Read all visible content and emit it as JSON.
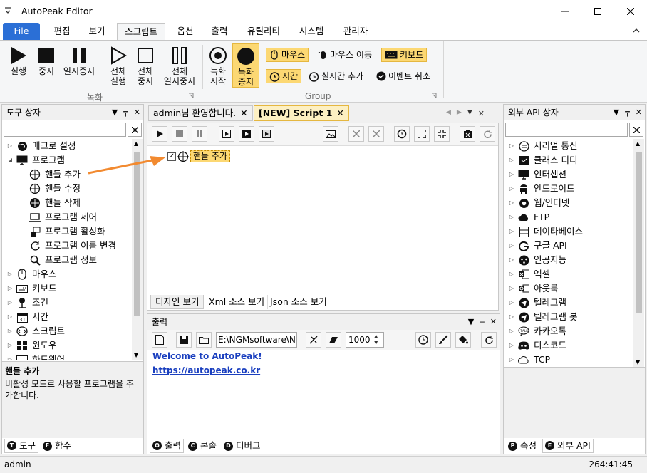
{
  "window": {
    "title": "AutoPeak Editor",
    "status_user": "admin",
    "status_time": "264:41:45"
  },
  "menu": {
    "file": "File",
    "items": [
      "편집",
      "보기",
      "스크립트",
      "옵션",
      "출력",
      "유틸리티",
      "시스템",
      "관리자"
    ]
  },
  "ribbon": {
    "record_group": "녹화",
    "group2": "Group",
    "run": "실행",
    "stop": "중지",
    "pause": "일시중지",
    "all_run": [
      "전체",
      "실행"
    ],
    "all_stop": [
      "전체",
      "중지"
    ],
    "all_pause": [
      "전체",
      "일시중지"
    ],
    "rec_start": [
      "녹화",
      "시작"
    ],
    "rec_stop": [
      "녹화",
      "중지"
    ],
    "mouse": "마우스",
    "mouse_move": "마우스 이동",
    "keyboard": "키보드",
    "time": "시간",
    "realtime_add": "실시간 추가",
    "event_cancel": "이벤트 취소"
  },
  "tool_box": {
    "title": "도구 상자",
    "items": [
      {
        "label": "매크로 설정",
        "icon": "globe-icon"
      },
      {
        "label": "프로그램",
        "icon": "monitor-icon"
      },
      {
        "label": "핸들 추가",
        "icon": "crosshair-icon"
      },
      {
        "label": "핸들 수정",
        "icon": "crosshair-icon"
      },
      {
        "label": "핸들 삭제",
        "icon": "crosshair-filled-icon"
      },
      {
        "label": "프로그램 제어",
        "icon": "laptop-icon"
      },
      {
        "label": "프로그램 활성화",
        "icon": "windows-stack-icon"
      },
      {
        "label": "프로그램 이름 변경",
        "icon": "rename-icon"
      },
      {
        "label": "프로그램 정보",
        "icon": "magnifier-icon"
      },
      {
        "label": "마우스",
        "icon": "mouse-icon"
      },
      {
        "label": "키보드",
        "icon": "keyboard-icon"
      },
      {
        "label": "조건",
        "icon": "condition-icon"
      },
      {
        "label": "시간",
        "icon": "calendar-icon"
      },
      {
        "label": "스크립트",
        "icon": "script-icon"
      },
      {
        "label": "윈도우",
        "icon": "windows-icon"
      },
      {
        "label": "하드웨어",
        "icon": "hardware-icon"
      }
    ],
    "desc_title": "핸들 추가",
    "desc_text": "비활성 모드로 사용할 프로그램을 추가합니다.",
    "tabs": [
      "도구",
      "함수"
    ],
    "tab_letters": [
      "T",
      "F"
    ]
  },
  "editor": {
    "tabs": [
      "admin님 환영합니다.",
      "[NEW] Script 1"
    ],
    "node_label": "핸들 추가",
    "view_tabs": [
      "디자인 보기",
      "Xml 소스 보기",
      "Json 소스 보기"
    ]
  },
  "output": {
    "title": "출력",
    "path": "E:\\NGMsoftware\\NG",
    "number": "1000",
    "welcome": "Welcome to AutoPeak!",
    "link": "https://autopeak.co.kr",
    "tabs": [
      "출력",
      "콘솔",
      "디버그"
    ],
    "tab_letters": [
      "O",
      "C",
      "D"
    ]
  },
  "api_box": {
    "title": "외부 API 상자",
    "items": [
      {
        "label": "시리얼 통신",
        "icon": "serial-icon"
      },
      {
        "label": "클래스 디디",
        "icon": "classdd-icon"
      },
      {
        "label": "인터셉션",
        "icon": "monitor-icon"
      },
      {
        "label": "안드로이드",
        "icon": "android-icon"
      },
      {
        "label": "웹/인터넷",
        "icon": "chrome-icon"
      },
      {
        "label": "FTP",
        "icon": "cloud-icon"
      },
      {
        "label": "데이타베이스",
        "icon": "database-icon"
      },
      {
        "label": "구글 API",
        "icon": "google-icon"
      },
      {
        "label": "인공지능",
        "icon": "ai-icon"
      },
      {
        "label": "엑셀",
        "icon": "excel-icon"
      },
      {
        "label": "아웃룩",
        "icon": "outlook-icon"
      },
      {
        "label": "텔레그램",
        "icon": "telegram-icon"
      },
      {
        "label": "텔레그램 봇",
        "icon": "telegram-icon"
      },
      {
        "label": "카카오톡",
        "icon": "kakao-icon"
      },
      {
        "label": "디스코드",
        "icon": "discord-icon"
      },
      {
        "label": "TCP",
        "icon": "tcp-icon"
      }
    ],
    "tabs": [
      "속성",
      "외부 API"
    ],
    "tab_letters": [
      "P",
      "E"
    ]
  },
  "colors": {
    "accent": "#2b6fd6",
    "highlight": "#fcd873",
    "arrow": "#f28a30",
    "link": "#1a3fbf"
  }
}
